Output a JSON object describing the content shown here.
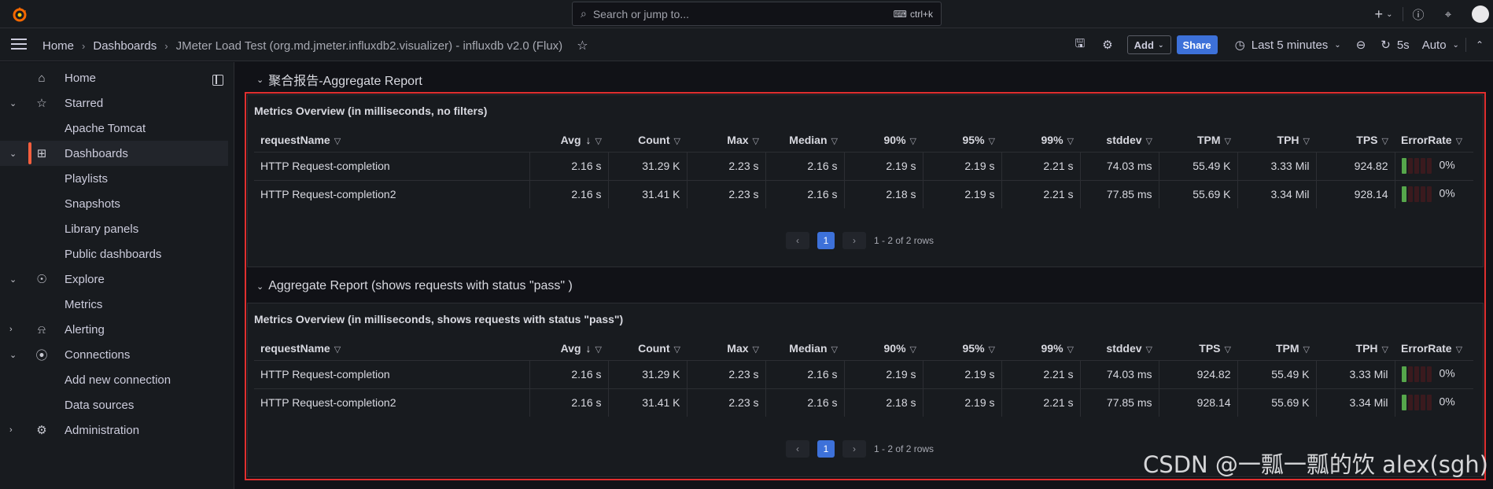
{
  "topbar": {
    "search_placeholder": "Search or jump to...",
    "search_shortcut": "ctrl+k",
    "plus_label": "+"
  },
  "breadcrumbs": [
    "Home",
    "Dashboards",
    "JMeter Load Test (org.md.jmeter.influxdb2.visualizer) - influxdb v2.0 (Flux)"
  ],
  "toolbar": {
    "add_label": "Add",
    "share_label": "Share",
    "time_range": "Last 5 minutes",
    "refresh_interval": "5s",
    "auto_label": "Auto"
  },
  "sidebar": {
    "items": [
      {
        "label": "Home",
        "icon": "home-icon"
      },
      {
        "label": "Starred",
        "icon": "star-icon"
      },
      {
        "label": "Apache Tomcat"
      },
      {
        "label": "Dashboards",
        "icon": "dashboards-icon"
      },
      {
        "label": "Playlists"
      },
      {
        "label": "Snapshots"
      },
      {
        "label": "Library panels"
      },
      {
        "label": "Public dashboards"
      },
      {
        "label": "Explore",
        "icon": "compass-icon"
      },
      {
        "label": "Metrics"
      },
      {
        "label": "Alerting",
        "icon": "bell-icon"
      },
      {
        "label": "Connections",
        "icon": "connections-icon"
      },
      {
        "label": "Add new connection"
      },
      {
        "label": "Data sources"
      },
      {
        "label": "Administration",
        "icon": "gear-icon"
      }
    ]
  },
  "rows": [
    {
      "title": "聚合报告-Aggregate Report"
    },
    {
      "title": "Aggregate Report (shows requests with status \"pass\" )"
    }
  ],
  "panels": [
    {
      "title": "Metrics Overview (in milliseconds, no filters)",
      "columns": [
        "requestName",
        "Avg",
        "Count",
        "Max",
        "Median",
        "90%",
        "95%",
        "99%",
        "stddev",
        "TPM",
        "TPH",
        "TPS",
        "ErrorRate"
      ],
      "rows": [
        [
          "HTTP Request-completion",
          "2.16 s",
          "31.29 K",
          "2.23 s",
          "2.16 s",
          "2.19 s",
          "2.19 s",
          "2.21 s",
          "74.03 ms",
          "55.49 K",
          "3.33 Mil",
          "924.82",
          "0%"
        ],
        [
          "HTTP Request-completion2",
          "2.16 s",
          "31.41 K",
          "2.23 s",
          "2.16 s",
          "2.18 s",
          "2.19 s",
          "2.21 s",
          "77.85 ms",
          "55.69 K",
          "3.34 Mil",
          "928.14",
          "0%"
        ]
      ],
      "page": "1",
      "row_summary": "1 - 2 of 2 rows"
    },
    {
      "title": "Metrics Overview (in milliseconds, shows requests with status \"pass\")",
      "columns": [
        "requestName",
        "Avg",
        "Count",
        "Max",
        "Median",
        "90%",
        "95%",
        "99%",
        "stddev",
        "TPS",
        "TPM",
        "TPH",
        "ErrorRate"
      ],
      "rows": [
        [
          "HTTP Request-completion",
          "2.16 s",
          "31.29 K",
          "2.23 s",
          "2.16 s",
          "2.19 s",
          "2.19 s",
          "2.21 s",
          "74.03 ms",
          "924.82",
          "55.49 K",
          "3.33 Mil",
          "0%"
        ],
        [
          "HTTP Request-completion2",
          "2.16 s",
          "31.41 K",
          "2.23 s",
          "2.16 s",
          "2.18 s",
          "2.19 s",
          "2.21 s",
          "77.85 ms",
          "928.14",
          "55.69 K",
          "3.34 Mil",
          "0%"
        ]
      ],
      "page": "1",
      "row_summary": "1 - 2 of 2 rows"
    }
  ],
  "watermark": "CSDN @一瓢一瓢的饮 alex(sgh)",
  "colors": {
    "accent": "#3d71d9",
    "active_bar": "#f55f3e",
    "highlight_box": "#e02f2f",
    "gauge_ok": "#56a64b"
  }
}
